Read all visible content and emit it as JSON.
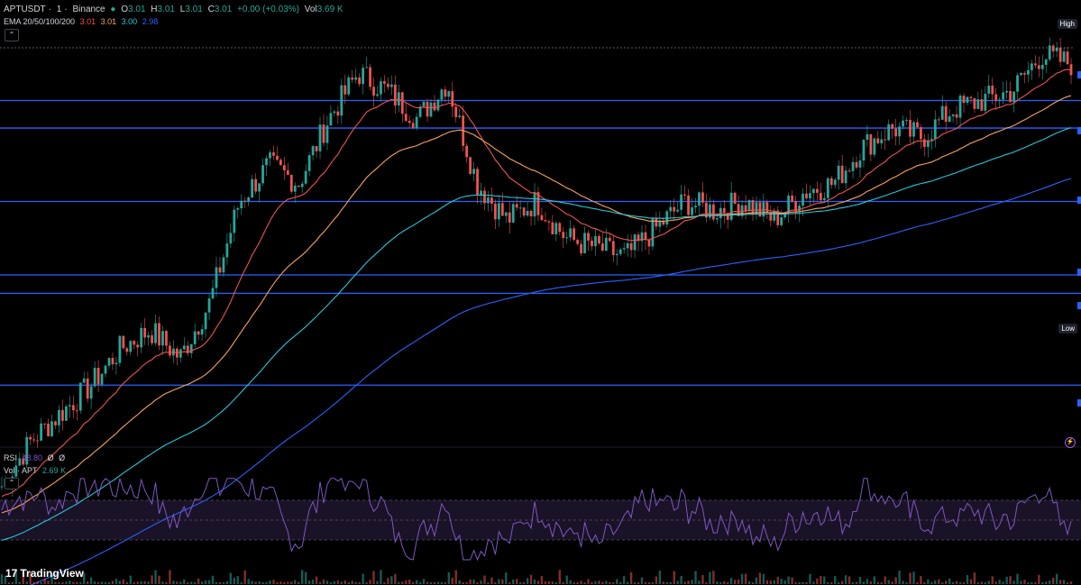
{
  "header": {
    "symbol": "APTUSDT",
    "interval": "1",
    "exchange": "Binance",
    "open_label": "O",
    "open": "3.01",
    "high_label": "H",
    "high": "3.01",
    "low_label": "L",
    "low": "3.01",
    "close_label": "C",
    "close": "3.01",
    "change": "+0.00 (+0.03%)",
    "vol_label": "Vol",
    "vol": "3.69 K"
  },
  "ema_legend": {
    "label": "EMA 20/50/100/200",
    "v1": "3.01",
    "v2": "3.01",
    "v3": "3.00",
    "v4": "2.98"
  },
  "rsi_legend": {
    "label": "RSI",
    "value": "48.80",
    "extra1": "Ø",
    "extra2": "Ø"
  },
  "vol_legend": {
    "label": "Vol · APT",
    "value": "2.69 K"
  },
  "tags": {
    "high": "High",
    "low": "Low"
  },
  "branding": {
    "logo": "TradingView",
    "logo_mark": "17"
  },
  "colors": {
    "background": "#000000",
    "up": "#26a69a",
    "down": "#ef5350",
    "ema20": "#ef5350",
    "ema50": "#f7a35c",
    "ema100": "#26c6da",
    "ema200": "#2962ff",
    "level_line": "#2962ff",
    "rsi": "#7e57c2",
    "rsi_band": "#1a1226"
  },
  "chart_data": {
    "type": "candlestick",
    "symbol": "APTUSDT",
    "interval": "1",
    "price_path": [
      2.55,
      2.6,
      2.63,
      2.66,
      2.7,
      2.72,
      2.69,
      2.75,
      2.86,
      2.9,
      2.88,
      2.95,
      3.0,
      2.98,
      2.95,
      2.99,
      2.88,
      2.84,
      2.86,
      2.82,
      2.81,
      2.8,
      2.83,
      2.86,
      2.85,
      2.86,
      2.84,
      2.87,
      2.88,
      2.92,
      2.94,
      2.93,
      2.96,
      2.97,
      2.98,
      3.02,
      3.01
    ],
    "horizontal_levels": [
      2.97,
      2.94,
      2.86,
      2.78,
      2.76,
      2.66
    ],
    "ema_legend_values": {
      "ema20": 3.01,
      "ema50": 3.01,
      "ema100": 3.0,
      "ema200": 2.98
    },
    "rsi": {
      "last": 48.8,
      "upper": 70,
      "mid": 50,
      "lower": 30
    },
    "volume_last": "2.69 K"
  }
}
